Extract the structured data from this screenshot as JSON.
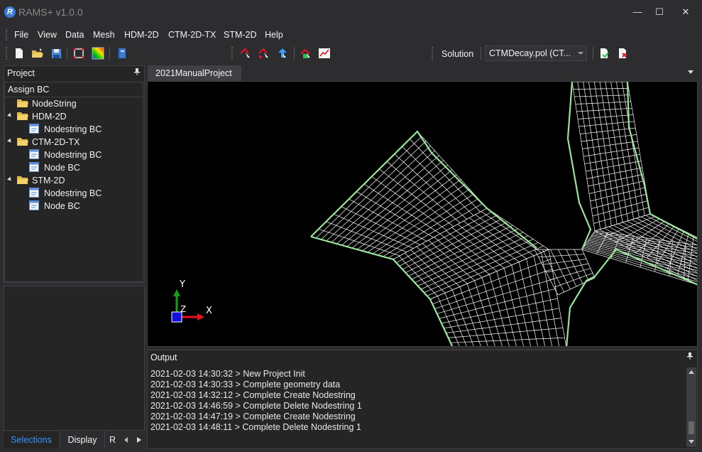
{
  "window": {
    "title": "RAMS+ v1.0.0",
    "logo_letter": "R",
    "minimize_glyph": "—",
    "maximize_glyph": "☐",
    "close_glyph": "✕"
  },
  "menu": [
    "File",
    "View",
    "Data",
    "Mesh",
    "HDM-2D",
    "CTM-2D-TX",
    "STM-2D",
    "Help"
  ],
  "toolbar": {
    "icons": [
      "new-file-icon",
      "open-folder-icon",
      "save-icon",
      "frame-icon",
      "color-map-icon",
      "book-icon",
      "node-pick-icon",
      "node-add-icon",
      "node-move-icon",
      "mesh-run-icon",
      "chart-icon",
      "export-icon",
      "delete-icon"
    ],
    "solution_label": "Solution",
    "solution_value": "CTMDecay.pol (CT..."
  },
  "project_panel": {
    "title": "Project",
    "pin": "📌",
    "root": "Assign BC",
    "tree": [
      {
        "label": "NodeString",
        "kind": "folder",
        "level": 0
      },
      {
        "label": "HDM-2D",
        "kind": "folder",
        "level": 0,
        "expanded": true
      },
      {
        "label": "Nodestring BC",
        "kind": "item",
        "level": 1
      },
      {
        "label": "CTM-2D-TX",
        "kind": "folder",
        "level": 0,
        "expanded": true
      },
      {
        "label": "Nodestring BC",
        "kind": "item",
        "level": 1
      },
      {
        "label": "Node BC",
        "kind": "item",
        "level": 1
      },
      {
        "label": "STM-2D",
        "kind": "folder",
        "level": 0,
        "expanded": true
      },
      {
        "label": "Nodestring BC",
        "kind": "item",
        "level": 1
      },
      {
        "label": "Node BC",
        "kind": "item",
        "level": 1
      }
    ]
  },
  "bottom_tabs": [
    {
      "label": "Selections",
      "active": true
    },
    {
      "label": "Display",
      "active": false
    },
    {
      "label": "R",
      "active": false
    }
  ],
  "document_tab": "2021ManualProject",
  "axes": {
    "x": "X",
    "y": "Y",
    "z": "Z"
  },
  "output": {
    "title": "Output",
    "lines": [
      "2021-02-03 14:30:32 > New Project Init",
      "2021-02-03 14:30:33 > Complete geometry data",
      "2021-02-03 14:32:12 > Complete Create Nodestring",
      "2021-02-03 14:46:59 > Complete Delete Nodestring 1",
      "2021-02-03 14:47:19 > Complete Create Nodestring",
      "2021-02-03 14:48:11 > Complete Delete Nodestring 1"
    ]
  },
  "colors": {
    "accent": "#3794ff",
    "mesh_boundary": "#98e59a",
    "mesh_grid": "#ffffff",
    "axis_x": "#e81123",
    "axis_y": "#16a016",
    "axis_origin": "#1010e0"
  }
}
